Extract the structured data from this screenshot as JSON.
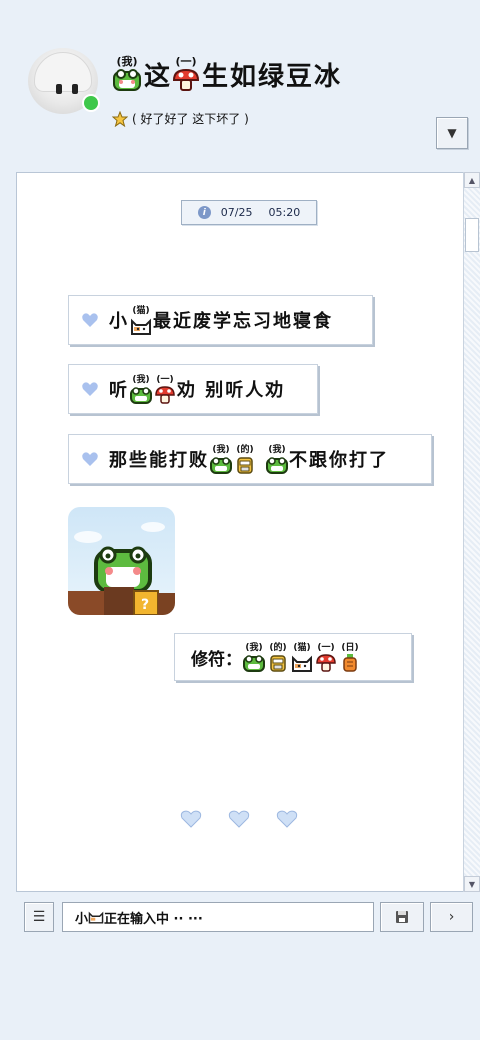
{
  "header": {
    "title_ruby_1": "(我)",
    "title_text_1": "这",
    "title_ruby_2": "(一)",
    "title_text_2": "生如绿豆冰",
    "subtitle": "( 好了好了  这下坏了 )",
    "dropdown_label": "▼"
  },
  "chat": {
    "timestamp": {
      "date": "07/25",
      "time": "05:20"
    },
    "messages": [
      {
        "pre": "小",
        "ruby": "(猫)",
        "post": "最近废学忘习地寝食"
      },
      {
        "pre": "听",
        "ruby1": "(我)",
        "ruby2": "(一)",
        "post": "劝  别听人劝"
      },
      {
        "pre": "那些能打败",
        "ruby1": "(我)",
        "ruby2": "(的)",
        "ruby3": "(我)",
        "post": "不跟你打了"
      }
    ],
    "runes": {
      "label": "修符：",
      "items": [
        "(我)",
        "(的)",
        "(猫)",
        "(一)",
        "(日)"
      ]
    }
  },
  "input_bar": {
    "menu_label": "☰",
    "typing_pre": "小",
    "typing_post": "正在输入中 ··  ···",
    "save_label": "💾",
    "send_label": "›"
  },
  "colors": {
    "accent": "#a9c1ee",
    "frog_green": "#5dbb3f",
    "online": "#3fc84a"
  }
}
